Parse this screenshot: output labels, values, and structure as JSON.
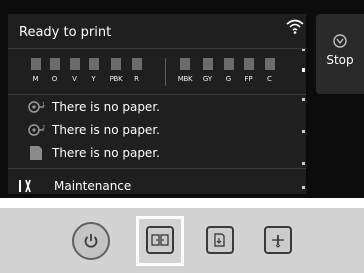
{
  "status": {
    "title": "Ready to print"
  },
  "ink": {
    "group1": [
      "M",
      "O",
      "V",
      "Y",
      "PBK",
      "R"
    ],
    "group2": [
      "MBK",
      "GY",
      "G",
      "FP",
      "C"
    ]
  },
  "paper": [
    {
      "icon": "roll-1-icon",
      "text": "There is no paper."
    },
    {
      "icon": "roll-2-icon",
      "text": "There is no paper."
    },
    {
      "icon": "sheet-icon",
      "text": "There is no paper."
    }
  ],
  "maintenance": {
    "label": "Maintenance",
    "icon": "maintenance-icon"
  },
  "stop": {
    "label": "Stop",
    "icon": "stop-icon"
  },
  "panel": {
    "power_icon": "power-icon",
    "keys": [
      "feed-paper-icon",
      "cut-paper-icon",
      "load-paper-icon"
    ]
  },
  "colors": {
    "screen_bg": "#0c0c0c",
    "panel_bg": "#d3d3d3",
    "ink_tank": "#6c6c6c",
    "text": "#ffffff"
  }
}
